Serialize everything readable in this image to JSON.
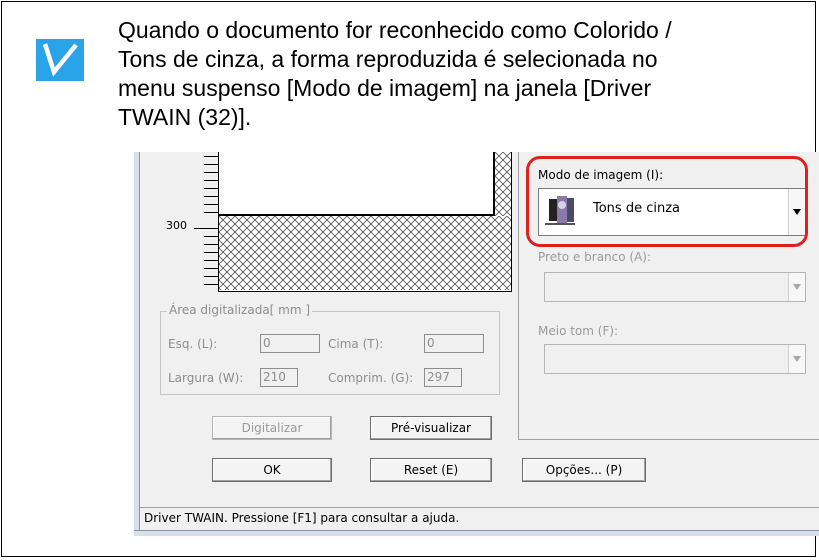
{
  "note": {
    "lines": [
      "Quando o documento for reconhecido como Colorido /",
      "Tons de cinza, a forma reproduzida é selecionada no",
      "menu suspenso [Modo de imagem] na janela [Driver",
      "TWAIN (32)]."
    ],
    "icon": "checkmark-icon",
    "icon_color": "#2aa3e8"
  },
  "dialog": {
    "ruler_label": "300",
    "scan_area": {
      "title": "Área digitalizada[ mm ]",
      "left_label": "Esq. (L):",
      "left_value": "0",
      "top_label": "Cima (T):",
      "top_value": "0",
      "width_label": "Largura (W):",
      "width_value": "210",
      "length_label": "Comprim. (G):",
      "length_value": "297"
    },
    "buttons": {
      "scan": "Digitalizar",
      "preview": "Pré-visualizar",
      "ok": "OK",
      "reset": "Reset (E)",
      "options": "Opções... (P)"
    },
    "image_mode": {
      "label": "Modo de imagem (I):",
      "selected": "Tons de cinza",
      "icon": "grayscale-mode-icon"
    },
    "black_white": {
      "label": "Preto e branco (A):"
    },
    "halftone": {
      "label": "Meio tom (F):"
    },
    "status_text": "Driver TWAIN. Pressione [F1] para consultar a ajuda.",
    "highlight_color": "#e0201c"
  }
}
